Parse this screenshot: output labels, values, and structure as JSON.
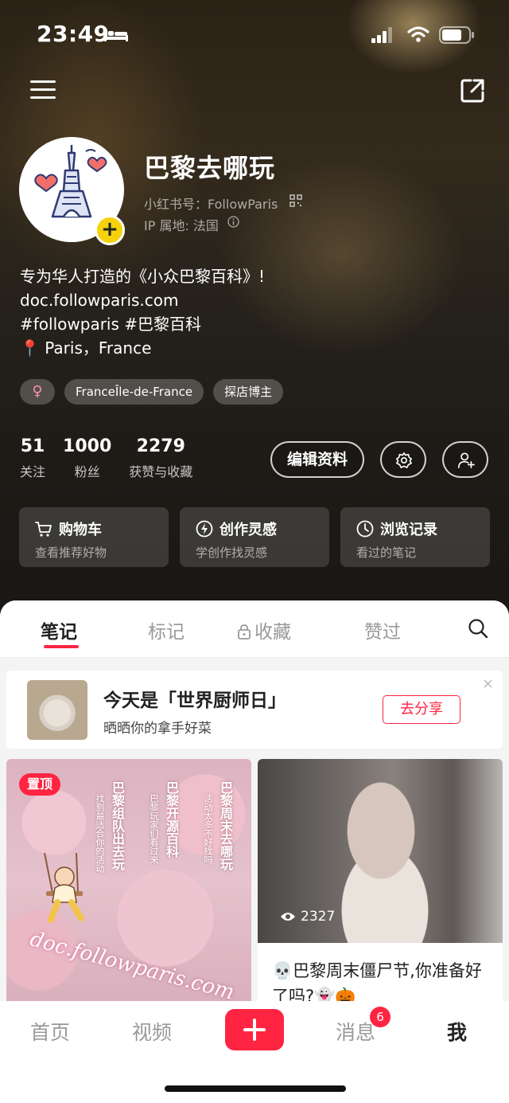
{
  "status": {
    "time": "23:49"
  },
  "profile": {
    "name": "巴黎去哪玩",
    "red_id": "小红书号：FollowParis",
    "ip": "IP 属地: 法国",
    "bio": [
      "专为华人打造的《小众巴黎百科》!",
      "doc.followparis.com",
      "#followparis #巴黎百科",
      "Paris，France"
    ],
    "bio_pin": "📍",
    "gender_symbol": "♀",
    "tags": [
      "FranceÎle-de-France",
      "探店博主"
    ]
  },
  "stats": [
    {
      "num": "51",
      "label": "关注"
    },
    {
      "num": "1000",
      "label": "粉丝"
    },
    {
      "num": "2279",
      "label": "获赞与收藏"
    }
  ],
  "buttons": {
    "edit": "编辑资料"
  },
  "cards": [
    {
      "title": "购物车",
      "sub": "查看推荐好物",
      "icon": "cart-icon"
    },
    {
      "title": "创作灵感",
      "sub": "学创作找灵感",
      "icon": "bolt-icon"
    },
    {
      "title": "浏览记录",
      "sub": "看过的笔记",
      "icon": "clock-icon"
    }
  ],
  "tabs": [
    "笔记",
    "标记",
    "收藏",
    "赞过"
  ],
  "promo": {
    "title": "今天是「世界厨师日」",
    "sub": "晒晒你的拿手好菜",
    "button": "去分享",
    "close": "×"
  },
  "notes": {
    "left": {
      "badge": "置顶",
      "col1": "巴黎周末去哪玩",
      "col1_sub": "活动太多不好找吗",
      "col2": "巴黎开源百科",
      "col2_sub": "巴黎玩家们看过来",
      "col3": "巴黎组队出去玩",
      "col3_sub": "找到最适合你的活动",
      "watermark": "doc.followparis.com"
    },
    "right": {
      "views": "2327",
      "title": "💀巴黎周末僵尸节,你准备好了吗?👻🎃"
    }
  },
  "bottomnav": {
    "home": "首页",
    "video": "视频",
    "messages": "消息",
    "messages_badge": "6",
    "me": "我"
  },
  "colors": {
    "accent": "#ff2442",
    "avatar_badge": "#f5d20b"
  }
}
